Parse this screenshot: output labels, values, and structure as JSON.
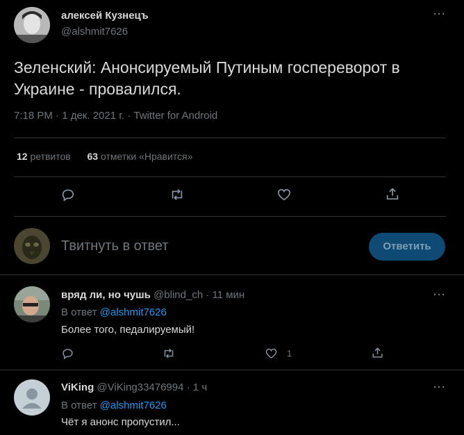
{
  "main_tweet": {
    "author_name": "алексей Кузнецъ",
    "author_handle": "@alshmit7626",
    "text_line1": "Зеленский: Анонсируемый Путиным госпереворот в",
    "text_line2": "Украине - провалился.",
    "meta": "7:18 PM · 1 дек. 2021 г. · Twitter for Android",
    "retweets_count": "12",
    "retweets_label": "ретвитов",
    "likes_count": "63",
    "likes_label": "отметки «Нравится»"
  },
  "compose": {
    "placeholder": "Твитнуть в ответ",
    "button_label": "Ответить"
  },
  "replies": [
    {
      "name": "вряд ли, но чушь",
      "handle": "@blind_ch",
      "time": "· 11 мин",
      "reply_to_prefix": "В ответ",
      "reply_to_handle": "@alshmit7626",
      "text": "Более того, педалируемый!",
      "like_count": "1"
    },
    {
      "name": "ViKing",
      "handle": "@ViKing33476994",
      "time": "· 1 ч",
      "reply_to_prefix": "В ответ",
      "reply_to_handle": "@alshmit7626",
      "text": "Чёт я анонс пропустил..."
    }
  ],
  "more_label": "···",
  "icons": [
    "more-icon",
    "reply-icon",
    "retweet-icon",
    "like-icon",
    "share-icon",
    "default-avatar-icon"
  ],
  "colors": {
    "background": "#000000",
    "accent": "#1d9bf0",
    "muted": "#6e767d",
    "text": "#d9d9d9"
  }
}
